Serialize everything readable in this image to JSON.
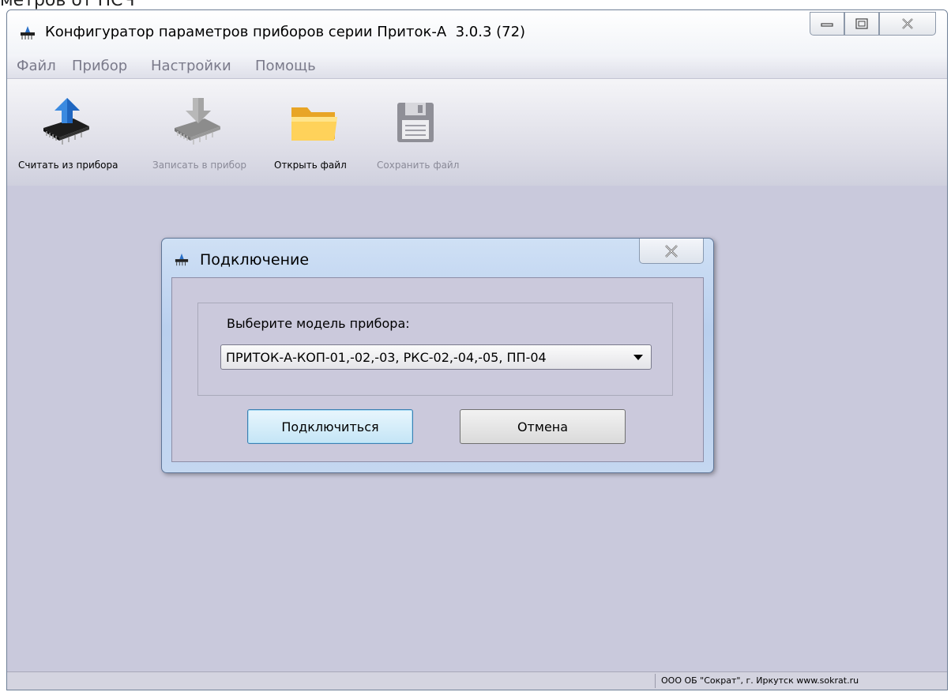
{
  "doc_fragment": "метров от ПСЧ",
  "window": {
    "title": "Конфигуратор параметров приборов серии Приток-А",
    "version": "3.0.3 (72)",
    "icon": "app-probe-icon"
  },
  "menu": [
    "Файл",
    "Прибор",
    "Настройки",
    "Помощь"
  ],
  "toolbar": {
    "read_label": "Считать из прибора",
    "write_label": "Записать в прибор",
    "open_label": "Открыть файл",
    "save_label": "Сохранить файл"
  },
  "dialog": {
    "title": "Подключение",
    "model_label": "Выберите модель прибора:",
    "model_value": "ПРИТОК-А-КОП-01,-02,-03, РКС-02,-04,-05, ПП-04",
    "connect_label": "Подключиться",
    "cancel_label": "Отмена"
  },
  "status": {
    "text": "ООО ОБ \"Сократ\", г. Иркутск  www.sokrat.ru"
  },
  "colors": {
    "client_bg": "#c9c9dc",
    "dialog_frame": "#b9cfee",
    "accent_button": "#c4e5f6"
  }
}
